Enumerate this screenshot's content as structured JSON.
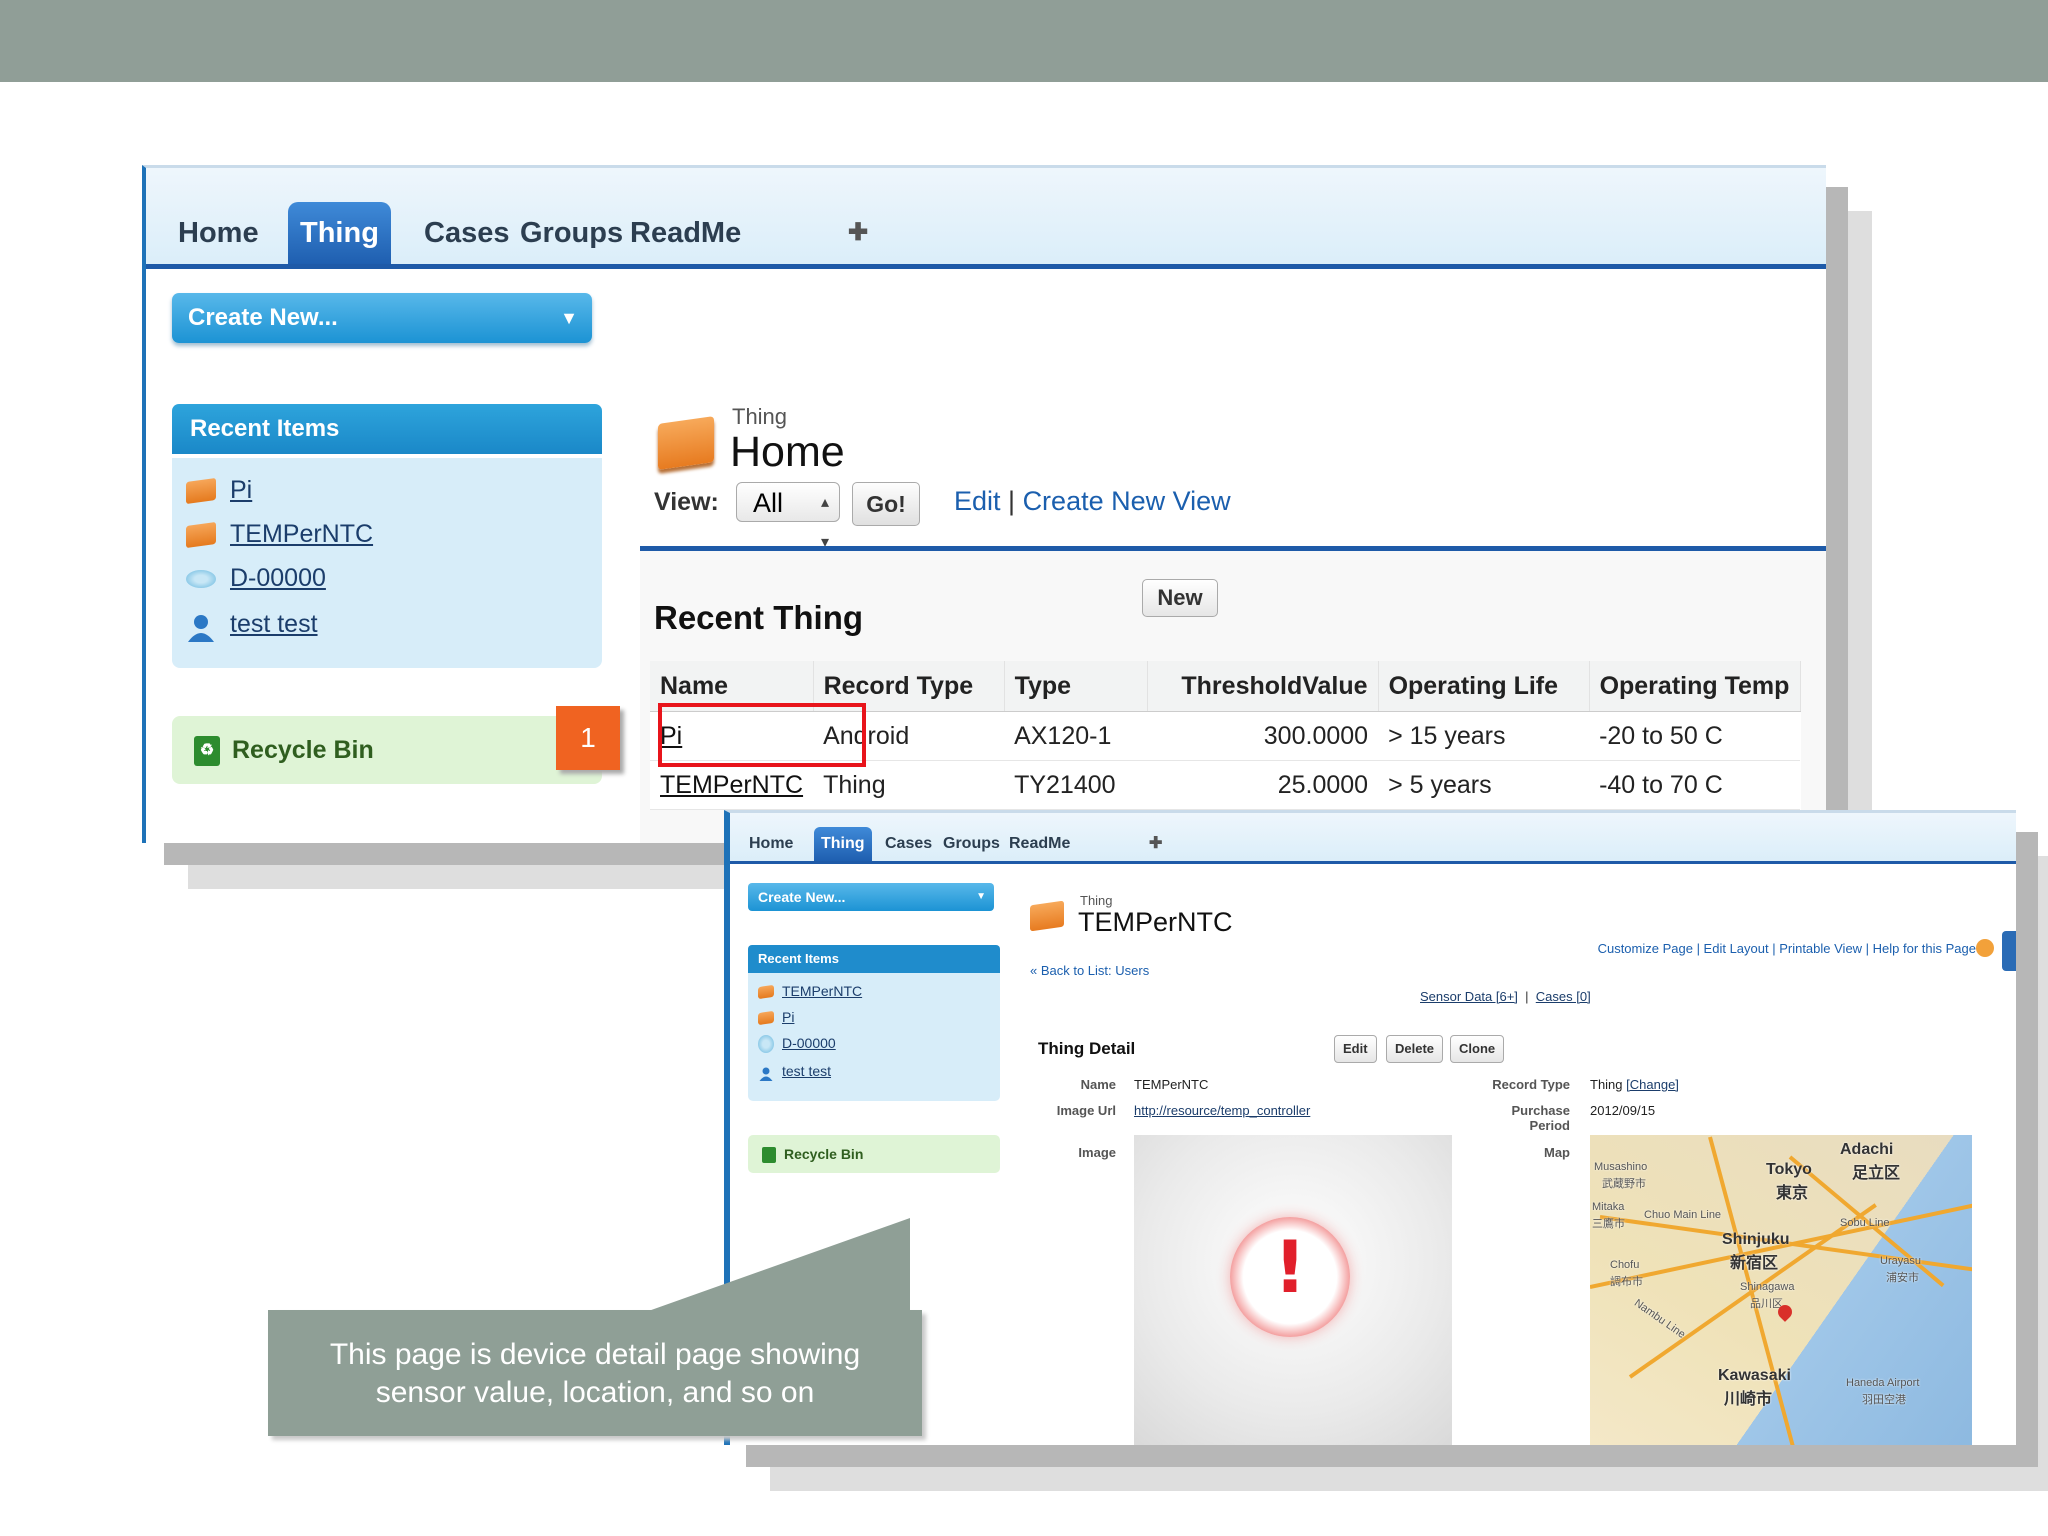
{
  "colors": {
    "banner": "#909e97",
    "tab_active": "#2f74c9",
    "accent_red": "#e8141b",
    "badge": "#f06321",
    "callout": "#8f9f96"
  },
  "main_screen": {
    "tabs": [
      "Home",
      "Thing",
      "Cases",
      "Groups",
      "ReadMe",
      "✚"
    ],
    "active_tab": "Thing",
    "create_new": "Create New...",
    "recent_items_title": "Recent Items",
    "recent_items": [
      {
        "label": "Pi",
        "icon": "thing-icon"
      },
      {
        "label": "TEMPerNTC",
        "icon": "thing-icon"
      },
      {
        "label": "D-00000",
        "icon": "disc-icon"
      },
      {
        "label": "test test",
        "icon": "user-icon"
      }
    ],
    "recycle_bin": "Recycle Bin",
    "badge_number": "1",
    "page_subtitle": "Thing",
    "page_title": "Home",
    "view_label": "View:",
    "view_selected": "All",
    "go_button": "Go!",
    "edit_link": "Edit",
    "create_view_link": "Create New View",
    "recent_title": "Recent Thing",
    "new_button": "New",
    "table": {
      "columns": [
        "Name",
        "Record Type",
        "Type",
        "ThresholdValue",
        "Operating Life",
        "Operating Temp"
      ],
      "rows": [
        [
          "Pi",
          "Android",
          "AX120-1",
          "300.0000",
          "> 15 years",
          "-20 to 50 C"
        ],
        [
          "TEMPerNTC",
          "Thing",
          "TY21400",
          "25.0000",
          "> 5 years",
          "-40 to 70 C"
        ]
      ]
    }
  },
  "detail_screen": {
    "tabs": [
      "Home",
      "Thing",
      "Cases",
      "Groups",
      "ReadMe",
      "✚"
    ],
    "active_tab": "Thing",
    "create_new": "Create New...",
    "recent_items_title": "Recent Items",
    "recent_items": [
      "TEMPerNTC",
      "Pi",
      "D-00000",
      "test test"
    ],
    "recycle_bin": "Recycle Bin",
    "page_subtitle": "Thing",
    "page_title": "TEMPerNTC",
    "help_links": "Customize Page | Edit Layout | Printable View | Help for this Page",
    "back_link": "« Back to List: Users",
    "related_links": [
      "Sensor Data [6+]",
      "Cases [0]"
    ],
    "detail_title": "Thing Detail",
    "buttons": [
      "Edit",
      "Delete",
      "Clone"
    ],
    "fields": {
      "name_label": "Name",
      "name_value": "TEMPerNTC",
      "image_url_label": "Image Url",
      "image_url_value": "http://resource/temp_controller",
      "image_label": "Image",
      "record_type_label": "Record Type",
      "record_type_value": "Thing",
      "record_type_change": "[Change]",
      "purchase_label": "Purchase Period",
      "purchase_value": "2012/09/15",
      "map_label": "Map"
    },
    "map_labels": [
      "Adachi",
      "足立区",
      "Tokyo",
      "東京",
      "Musashino",
      "武蔵野市",
      "Mitaka",
      "三鷹市",
      "Chuo Main Line",
      "Shinjuku",
      "新宿区",
      "Sobu Line",
      "Chofu",
      "調布市",
      "Shinagawa",
      "品川区",
      "Urayasu",
      "浦安市",
      "Nambu Line",
      "Kawasaki",
      "川崎市",
      "Haneda Airport",
      "羽田空港"
    ]
  },
  "callout": {
    "line1": "This page is device detail page showing",
    "line2": "sensor value, location, and so on"
  }
}
